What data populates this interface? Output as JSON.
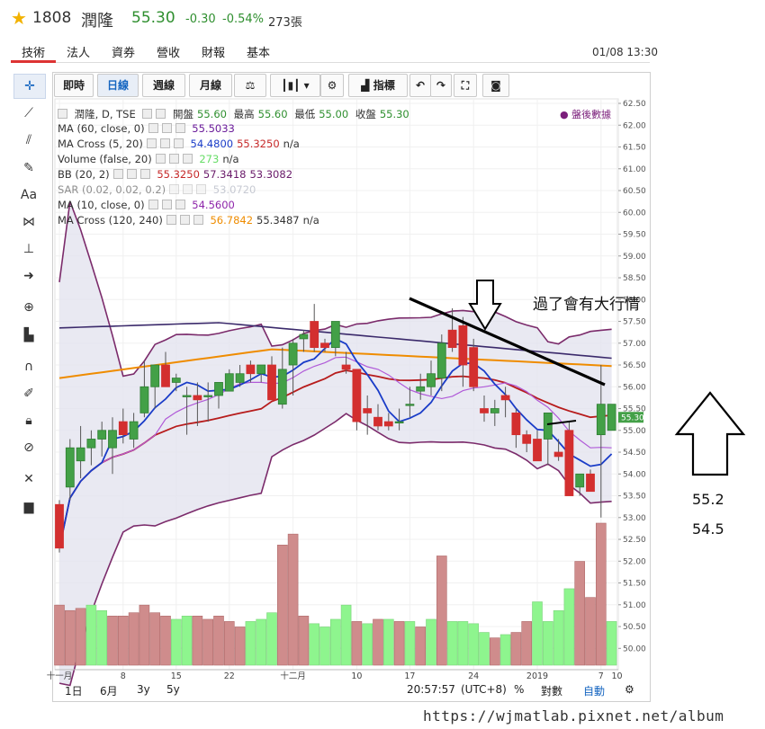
{
  "header": {
    "code": "1808",
    "name": "潤隆",
    "price": "55.30",
    "change": "-0.30",
    "change_pct": "-0.54%",
    "volume": "273張",
    "datetime": "01/08 13:30"
  },
  "nav_tabs": [
    "技術",
    "法人",
    "資券",
    "營收",
    "財報",
    "基本"
  ],
  "toolbar": {
    "intraday": "即時",
    "daily": "日線",
    "weekly": "週線",
    "monthly": "月線",
    "indicators": "指標"
  },
  "legend": {
    "title": "潤隆, D, TSE",
    "ohlc": {
      "open_label": "開盤",
      "open": "55.60",
      "high_label": "最高",
      "high": "55.60",
      "low_label": "最低",
      "low": "55.00",
      "close_label": "收盤",
      "close": "55.30"
    },
    "rows": [
      {
        "label": "MA (60, close, 0)",
        "values": [
          "55.5033"
        ],
        "colors": [
          "#6a1b9a"
        ]
      },
      {
        "label": "MA Cross (5, 20)",
        "values": [
          "54.4800",
          "55.3250",
          "n/a"
        ],
        "colors": [
          "#1a3cc8",
          "#c62828",
          "#333333"
        ]
      },
      {
        "label": "Volume (false, 20)",
        "values": [
          "273",
          "n/a"
        ],
        "colors": [
          "#66dd66",
          "#333333"
        ]
      },
      {
        "label": "BB (20, 2)",
        "values": [
          "55.3250",
          "57.3418",
          "53.3082"
        ],
        "colors": [
          "#c62828",
          "#6a1b6a",
          "#6a1b6a"
        ]
      },
      {
        "label": "SAR (0.02, 0.02, 0.2)",
        "values": [
          "53.0720"
        ],
        "colors": [
          "#9aa0b0"
        ]
      },
      {
        "label": "MA (10, close, 0)",
        "values": [
          "54.5600"
        ],
        "colors": [
          "#8e24aa"
        ]
      },
      {
        "label": "MA Cross (120, 240)",
        "values": [
          "56.7842",
          "55.3487",
          "n/a"
        ],
        "colors": [
          "#ef8c00",
          "#333333",
          "#333333"
        ]
      }
    ],
    "after_hours": "盤後數據"
  },
  "chart_data": {
    "type": "candlestick",
    "ylim": [
      49.8,
      62.5
    ],
    "y_ticks": [
      "62.50",
      "62.00",
      "61.50",
      "61.00",
      "60.50",
      "60.00",
      "59.50",
      "59.00",
      "58.50",
      "58.00",
      "57.50",
      "57.00",
      "56.50",
      "56.00",
      "55.50",
      "55.30",
      "55.00",
      "54.50",
      "54.00",
      "53.50",
      "53.00",
      "52.50",
      "52.00",
      "51.50",
      "51.00",
      "50.50",
      "50.00"
    ],
    "last_price_label": "55.30",
    "x_ticks": [
      "十一月",
      "8",
      "15",
      "22",
      "十二月",
      "10",
      "17",
      "24",
      "2019",
      "7",
      "10"
    ],
    "candles": [
      {
        "o": 53.3,
        "h": 53.4,
        "l": 52.2,
        "c": 52.3
      },
      {
        "o": 53.7,
        "h": 54.8,
        "l": 53.4,
        "c": 54.6
      },
      {
        "o": 54.3,
        "h": 55.1,
        "l": 53.9,
        "c": 54.6
      },
      {
        "o": 54.6,
        "h": 55.0,
        "l": 54.2,
        "c": 54.8
      },
      {
        "o": 54.8,
        "h": 55.2,
        "l": 54.4,
        "c": 55.0
      },
      {
        "o": 54.6,
        "h": 55.3,
        "l": 54.0,
        "c": 55.0
      },
      {
        "o": 55.2,
        "h": 55.5,
        "l": 54.7,
        "c": 54.9
      },
      {
        "o": 54.8,
        "h": 55.4,
        "l": 54.6,
        "c": 55.2
      },
      {
        "o": 55.4,
        "h": 56.6,
        "l": 55.3,
        "c": 56.0
      },
      {
        "o": 56.0,
        "h": 56.3,
        "l": 55.5,
        "c": 56.5
      },
      {
        "o": 56.5,
        "h": 56.8,
        "l": 56.0,
        "c": 56.0
      },
      {
        "o": 56.1,
        "h": 56.3,
        "l": 55.9,
        "c": 56.2
      },
      {
        "o": 55.8,
        "h": 56.0,
        "l": 54.9,
        "c": 55.8
      },
      {
        "o": 55.8,
        "h": 56.1,
        "l": 55.1,
        "c": 55.7
      },
      {
        "o": 55.8,
        "h": 56.1,
        "l": 55.2,
        "c": 55.8
      },
      {
        "o": 55.8,
        "h": 56.1,
        "l": 55.5,
        "c": 56.1
      },
      {
        "o": 55.9,
        "h": 56.4,
        "l": 55.9,
        "c": 56.3
      },
      {
        "o": 56.1,
        "h": 56.5,
        "l": 56.0,
        "c": 56.3
      },
      {
        "o": 56.5,
        "h": 56.6,
        "l": 56.1,
        "c": 56.3
      },
      {
        "o": 56.3,
        "h": 56.5,
        "l": 56.1,
        "c": 56.5
      },
      {
        "o": 56.5,
        "h": 56.7,
        "l": 55.7,
        "c": 55.7
      },
      {
        "o": 55.6,
        "h": 56.9,
        "l": 55.5,
        "c": 56.4
      },
      {
        "o": 56.5,
        "h": 57.1,
        "l": 55.8,
        "c": 57.0
      },
      {
        "o": 57.1,
        "h": 57.3,
        "l": 56.8,
        "c": 57.2
      },
      {
        "o": 57.5,
        "h": 57.9,
        "l": 56.8,
        "c": 56.9
      },
      {
        "o": 57.0,
        "h": 57.1,
        "l": 56.8,
        "c": 56.9
      },
      {
        "o": 56.9,
        "h": 57.4,
        "l": 56.7,
        "c": 57.5
      },
      {
        "o": 56.5,
        "h": 56.8,
        "l": 56.3,
        "c": 56.4
      },
      {
        "o": 56.4,
        "h": 56.4,
        "l": 55.0,
        "c": 55.2
      },
      {
        "o": 55.5,
        "h": 55.8,
        "l": 54.9,
        "c": 55.4
      },
      {
        "o": 55.3,
        "h": 55.6,
        "l": 55.0,
        "c": 55.1
      },
      {
        "o": 55.2,
        "h": 55.4,
        "l": 55.0,
        "c": 55.1
      },
      {
        "o": 55.2,
        "h": 55.5,
        "l": 55.0,
        "c": 55.2
      },
      {
        "o": 55.6,
        "h": 56.0,
        "l": 55.3,
        "c": 55.6
      },
      {
        "o": 55.9,
        "h": 56.3,
        "l": 55.7,
        "c": 56.0
      },
      {
        "o": 56.0,
        "h": 56.6,
        "l": 55.8,
        "c": 56.3
      },
      {
        "o": 56.2,
        "h": 57.2,
        "l": 55.9,
        "c": 57.0
      },
      {
        "o": 57.3,
        "h": 57.8,
        "l": 56.8,
        "c": 56.9
      },
      {
        "o": 57.4,
        "h": 57.6,
        "l": 56.0,
        "c": 56.5
      },
      {
        "o": 56.9,
        "h": 57.1,
        "l": 55.9,
        "c": 56.0
      },
      {
        "o": 55.5,
        "h": 55.8,
        "l": 55.2,
        "c": 55.4
      },
      {
        "o": 55.4,
        "h": 55.7,
        "l": 55.1,
        "c": 55.5
      },
      {
        "o": 55.8,
        "h": 56.0,
        "l": 55.3,
        "c": 55.7
      },
      {
        "o": 55.4,
        "h": 55.5,
        "l": 54.6,
        "c": 54.9
      },
      {
        "o": 54.9,
        "h": 55.0,
        "l": 54.5,
        "c": 54.7
      },
      {
        "o": 54.8,
        "h": 55.0,
        "l": 54.3,
        "c": 54.3
      },
      {
        "o": 54.8,
        "h": 55.2,
        "l": 54.2,
        "c": 55.4
      },
      {
        "o": 54.5,
        "h": 54.8,
        "l": 54.3,
        "c": 54.4
      },
      {
        "o": 55.0,
        "h": 55.2,
        "l": 53.5,
        "c": 53.5
      },
      {
        "o": 53.7,
        "h": 54.0,
        "l": 53.5,
        "c": 54.0
      },
      {
        "o": 54.0,
        "h": 54.1,
        "l": 53.6,
        "c": 53.6
      },
      {
        "o": 54.9,
        "h": 56.5,
        "l": 53.0,
        "c": 55.6
      },
      {
        "o": 55.0,
        "h": 55.6,
        "l": 55.0,
        "c": 55.6
      }
    ],
    "volumes": [
      [
        1,
        55,
        false
      ],
      [
        1,
        50,
        false
      ],
      [
        1,
        52,
        false
      ],
      [
        1,
        55,
        true
      ],
      [
        1,
        50,
        true
      ],
      [
        1,
        45,
        false
      ],
      [
        1,
        45,
        false
      ],
      [
        1,
        48,
        false
      ],
      [
        1,
        55,
        false
      ],
      [
        1,
        48,
        false
      ],
      [
        1,
        45,
        false
      ],
      [
        1,
        42,
        true
      ],
      [
        1,
        45,
        true
      ],
      [
        1,
        45,
        false
      ],
      [
        1,
        42,
        false
      ],
      [
        1,
        45,
        false
      ],
      [
        1,
        40,
        false
      ],
      [
        1,
        35,
        false
      ],
      [
        1,
        40,
        true
      ],
      [
        1,
        42,
        true
      ],
      [
        1,
        48,
        true
      ],
      [
        1,
        110,
        false
      ],
      [
        1,
        120,
        false
      ],
      [
        1,
        45,
        false
      ],
      [
        1,
        38,
        true
      ],
      [
        1,
        35,
        true
      ],
      [
        1,
        42,
        true
      ],
      [
        1,
        55,
        true
      ],
      [
        1,
        40,
        false
      ],
      [
        1,
        38,
        true
      ],
      [
        1,
        42,
        false
      ],
      [
        1,
        42,
        true
      ],
      [
        1,
        40,
        false
      ],
      [
        1,
        40,
        true
      ],
      [
        1,
        35,
        false
      ],
      [
        1,
        42,
        true
      ],
      [
        1,
        100,
        false
      ],
      [
        1,
        40,
        true
      ],
      [
        1,
        40,
        true
      ],
      [
        1,
        38,
        true
      ],
      [
        1,
        30,
        true
      ],
      [
        1,
        25,
        false
      ],
      [
        1,
        28,
        true
      ],
      [
        1,
        30,
        false
      ],
      [
        1,
        40,
        false
      ],
      [
        1,
        58,
        true
      ],
      [
        1,
        40,
        true
      ],
      [
        1,
        50,
        true
      ],
      [
        1,
        70,
        true
      ],
      [
        1,
        95,
        false
      ],
      [
        1,
        62,
        false
      ],
      [
        1,
        130,
        false
      ],
      [
        1,
        40,
        true
      ]
    ]
  },
  "overlay": {
    "annotation": "過了會有大行情",
    "numbers": [
      "55.2",
      "54.5"
    ]
  },
  "bottom": {
    "range1": "1日",
    "range2": "6月",
    "range3": "3y",
    "range4": "5y",
    "time": "20:57:57",
    "tz": "(UTC+8)",
    "pct": "%",
    "log": "對數",
    "auto": "自動"
  },
  "watermark": "https://wjmatlab.pixnet.net/album"
}
